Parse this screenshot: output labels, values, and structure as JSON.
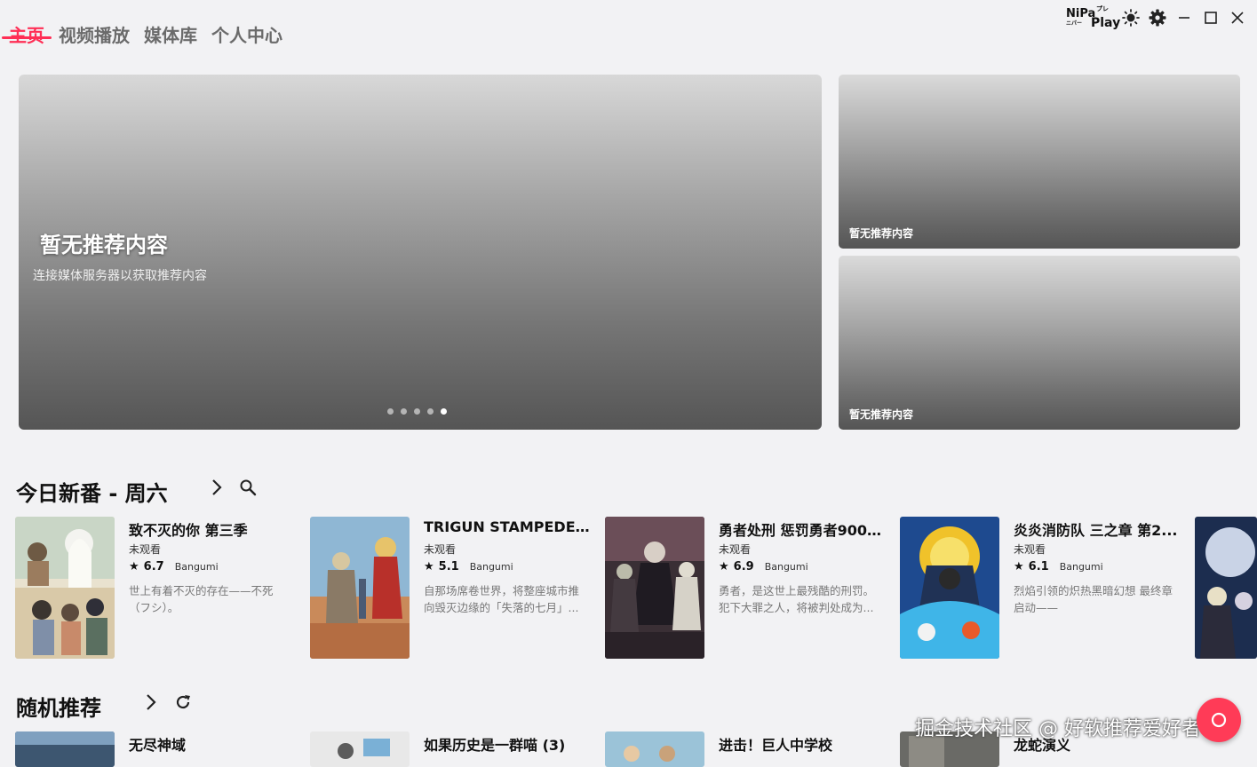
{
  "nav": {
    "tabs": [
      {
        "label": "主页",
        "active": true
      },
      {
        "label": "视频播放",
        "active": false
      },
      {
        "label": "媒体库",
        "active": false
      },
      {
        "label": "个人中心",
        "active": false
      }
    ]
  },
  "app": {
    "logo_text_1": "NiPa",
    "logo_text_2": "Play",
    "logo_small_1": "プレ",
    "logo_small_2": "ニパー"
  },
  "window_controls": [
    "theme-icon",
    "gear-icon",
    "minimize-icon",
    "maximize-icon",
    "close-icon"
  ],
  "hero": {
    "title": "暂无推荐内容",
    "subtitle": "连接媒体服务器以获取推荐内容",
    "dot_count": 5,
    "active_dot": 4,
    "side": [
      {
        "caption": "暂无推荐内容"
      },
      {
        "caption": "暂无推荐内容"
      }
    ]
  },
  "today": {
    "title": "今日新番 - 周六",
    "cards": [
      {
        "title": "致不灭的你 第三季",
        "status": "未观看",
        "rating": "6.7",
        "source": "Bangumi",
        "desc": "世上有着不灭的存在——不死（フシ）。"
      },
      {
        "title": "TRIGUN STAMPEDE (...",
        "status": "未观看",
        "rating": "5.1",
        "source": "Bangumi",
        "desc": "自那场席卷世界，将整座城市推向毁灭边缘的「失落的七月」..."
      },
      {
        "title": "勇者处刑 惩罚勇者9004...",
        "status": "未观看",
        "rating": "6.9",
        "source": "Bangumi",
        "desc": "勇者，是这世上最残酷的刑罚。犯下大罪之人，将被判处成为..."
      },
      {
        "title": "炎炎消防队 三之章 第2...",
        "status": "未观看",
        "rating": "6.1",
        "source": "Bangumi",
        "desc": "烈焰引领的炽热黑暗幻想 最终章启动——"
      }
    ]
  },
  "random": {
    "title": "随机推荐",
    "cards": [
      {
        "title": "无尽神域"
      },
      {
        "title": "如果历史是一群喵 (3)"
      },
      {
        "title": "进击！巨人中学校"
      },
      {
        "title": "龙蛇演义"
      }
    ]
  },
  "watermark": "掘金技术社区 @ 好软推荐爱好者",
  "colors": {
    "accent": "#ff2e55",
    "fab": "#ff3b57"
  }
}
